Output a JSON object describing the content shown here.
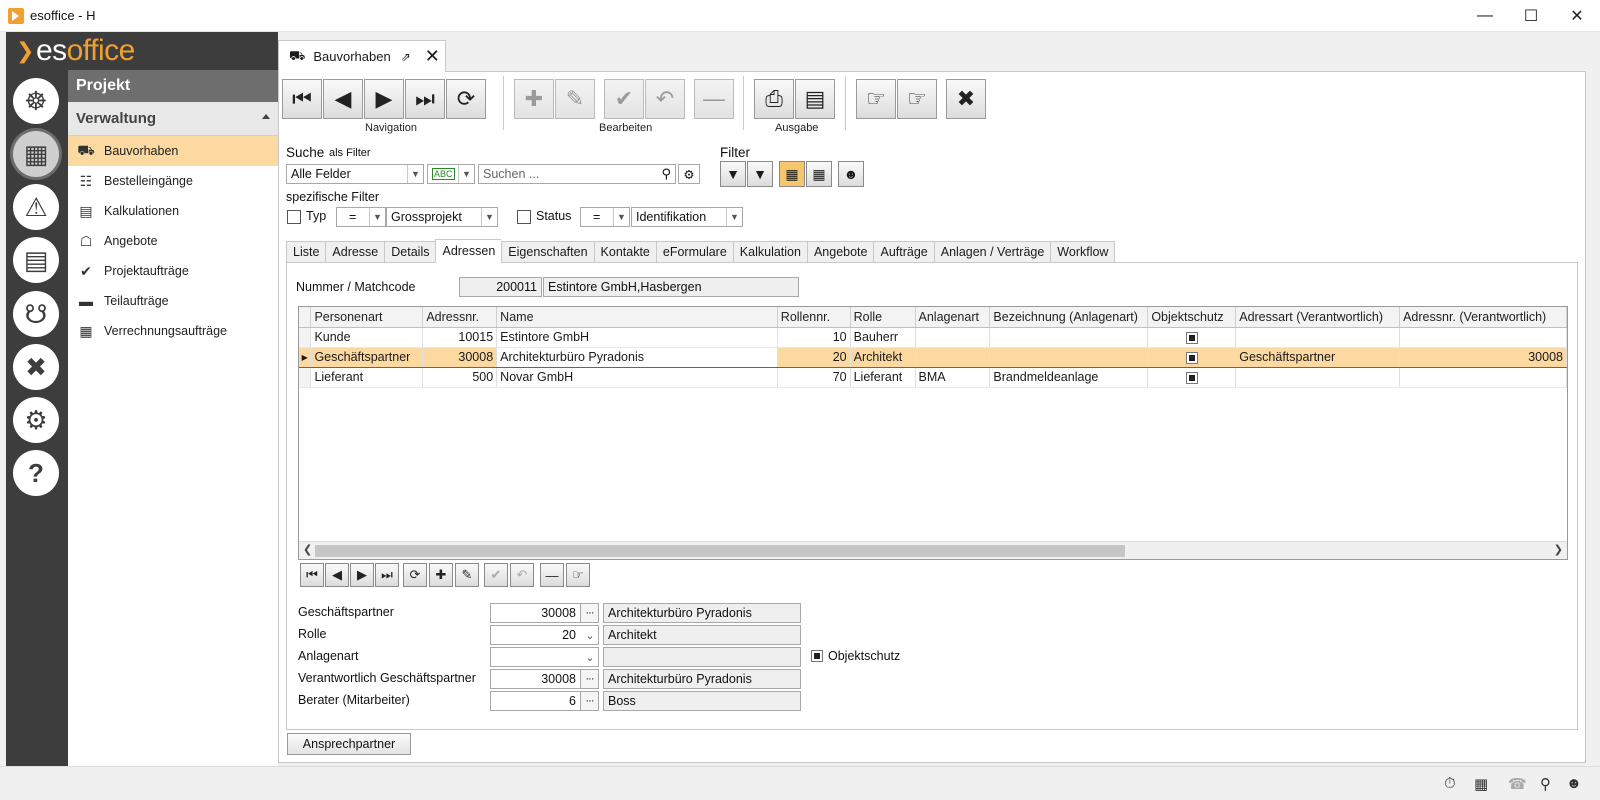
{
  "window": {
    "title": "esoffice - H"
  },
  "logo": {
    "text_prefix": "es",
    "text_suffix": "office"
  },
  "rail": {
    "icons": [
      "helm-icon",
      "projects-icon",
      "alarm-icon",
      "finance-icon",
      "headset-icon",
      "tools-icon",
      "settings-icon",
      "help-icon"
    ]
  },
  "sidebar": {
    "module_title": "Projekt",
    "section_title": "Verwaltung",
    "items": [
      {
        "label": "Bauvorhaben",
        "icon": "construction-icon"
      },
      {
        "label": "Bestelleingänge",
        "icon": "cart-icon"
      },
      {
        "label": "Kalkulationen",
        "icon": "calculation-icon"
      },
      {
        "label": "Angebote",
        "icon": "offer-tag-icon"
      },
      {
        "label": "Projektaufträge",
        "icon": "check-circle-icon"
      },
      {
        "label": "Teilaufträge",
        "icon": "partial-order-icon"
      },
      {
        "label": "Verrechnungsaufträge",
        "icon": "billing-icon"
      }
    ]
  },
  "doc_tab": {
    "label": "Bauvorhaben"
  },
  "toolbar": {
    "groups": [
      {
        "label": "Navigation"
      },
      {
        "label": "Bearbeiten"
      },
      {
        "label": "Ausgabe"
      }
    ]
  },
  "search": {
    "label": "Suche",
    "as_filter": "als Filter",
    "field_select": "Alle Felder",
    "placeholder": "Suchen ...",
    "filter_label": "Filter"
  },
  "specific_filter": {
    "label": "spezifische Filter",
    "typ_label": "Typ",
    "typ_op": "=",
    "typ_value": "Grossprojekt",
    "status_label": "Status",
    "status_op": "=",
    "status_value": "Identifikation"
  },
  "subtabs": [
    "Liste",
    "Adresse",
    "Details",
    "Adressen",
    "Eigenschaften",
    "Kontakte",
    "eFormulare",
    "Kalkulation",
    "Angebote",
    "Aufträge",
    "Anlagen / Verträge",
    "Workflow"
  ],
  "matchcode": {
    "label": "Nummer / Matchcode",
    "number": "200011",
    "name": "Estintore GmbH,Hasbergen"
  },
  "grid": {
    "columns": [
      "Personenart",
      "Adressnr.",
      "Name",
      "Rollennr.",
      "Rolle",
      "Anlagenart",
      "Bezeichnung (Anlagenart)",
      "Objektschutz",
      "Adressart (Verantwortlich)",
      "Adressnr. (Verantwortlich)"
    ],
    "rows": [
      {
        "personenart": "Kunde",
        "adressnr": "10015",
        "name": "Estintore GmbH",
        "rollennr": "10",
        "rolle": "Bauherr",
        "anlagenart": "",
        "bezeichnung": "",
        "adressart": "",
        "adressnr_v": ""
      },
      {
        "personenart": "Geschäftspartner",
        "adressnr": "30008",
        "name": "Architekturbüro Pyradonis",
        "rollennr": "20",
        "rolle": "Architekt",
        "anlagenart": "",
        "bezeichnung": "",
        "adressart": "Geschäftspartner",
        "adressnr_v": "30008"
      },
      {
        "personenart": "Lieferant",
        "adressnr": "500",
        "name": "Novar GmbH",
        "rollennr": "70",
        "rolle": "Lieferant",
        "anlagenart": "BMA",
        "bezeichnung": "Brandmeldeanlage",
        "adressart": "",
        "adressnr_v": ""
      }
    ]
  },
  "detail": {
    "geschaeftspartner_label": "Geschäftspartner",
    "geschaeftspartner_nr": "30008",
    "geschaeftspartner_name": "Architekturbüro Pyradonis",
    "rolle_label": "Rolle",
    "rolle_nr": "20",
    "rolle_name": "Architekt",
    "anlagenart_label": "Anlagenart",
    "objektschutz_label": "Objektschutz",
    "verantwortlich_label": "Verantwortlich Geschäftspartner",
    "verantwortlich_nr": "30008",
    "verantwortlich_name": "Architekturbüro Pyradonis",
    "berater_label": "Berater (Mitarbeiter)",
    "berater_nr": "6",
    "berater_name": "Boss",
    "ansprechpartner_button": "Ansprechpartner"
  },
  "colors": {
    "accent": "#f0a030",
    "selection": "#fcd9a0",
    "rail": "#3d3d3d"
  }
}
